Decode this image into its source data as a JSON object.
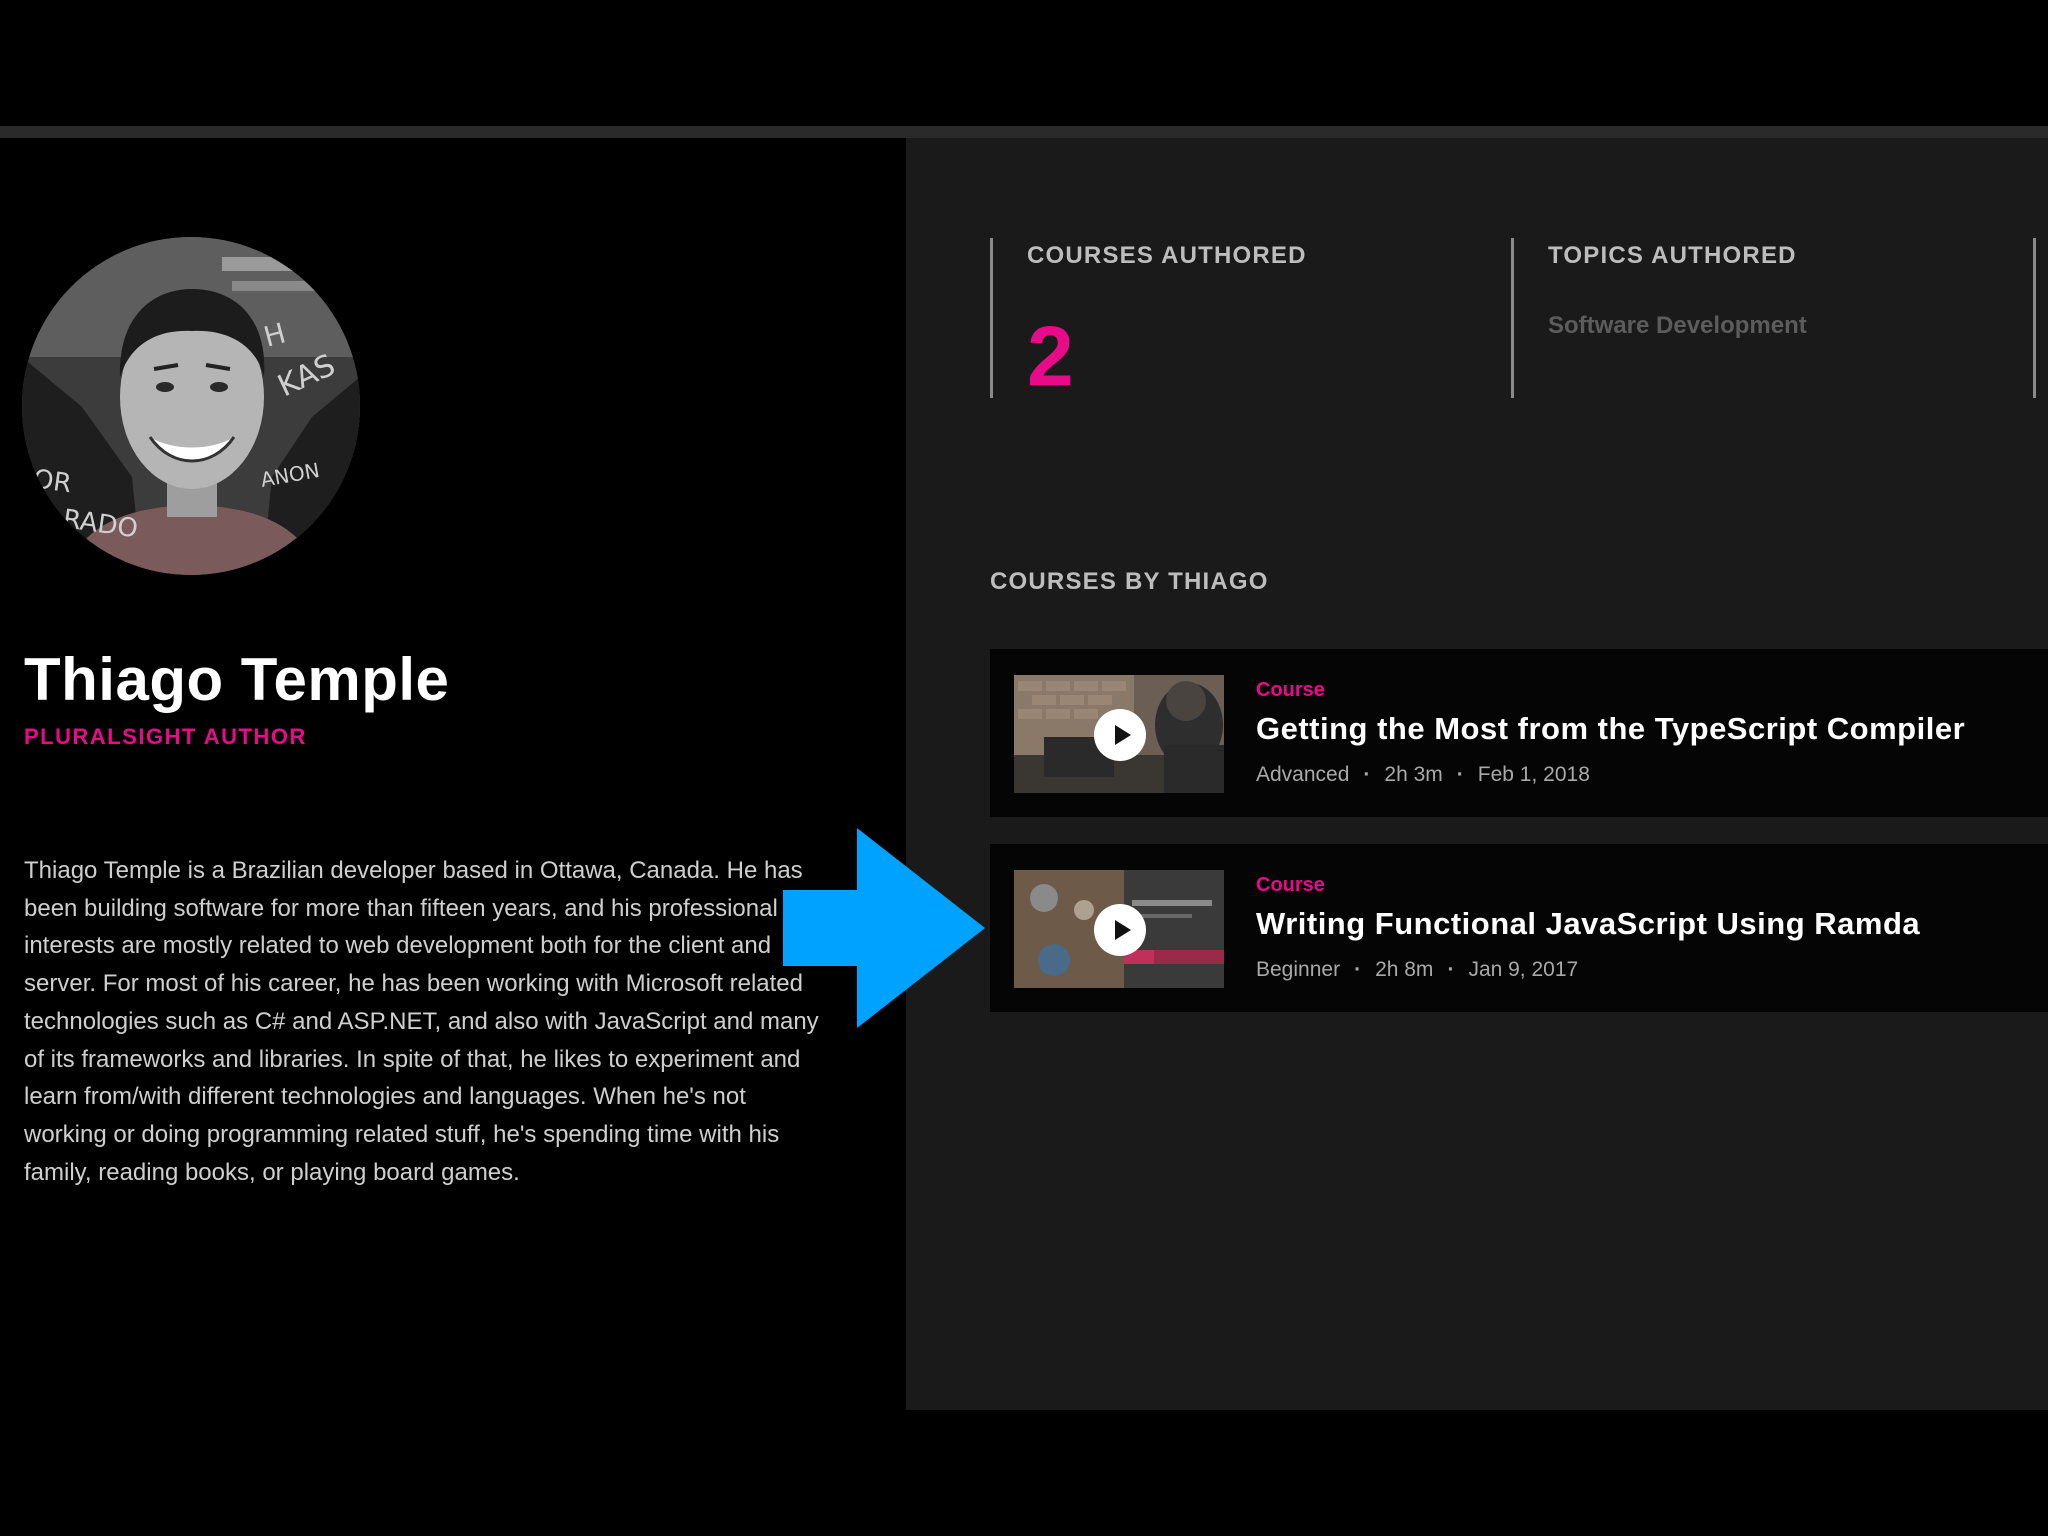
{
  "author": {
    "name": "Thiago Temple",
    "role": "PLURALSIGHT AUTHOR",
    "bio": "Thiago Temple is a Brazilian developer based in Ottawa, Canada. He has been building software for more than fifteen years, and his professional interests are mostly related to web development both for the client and server. For most of his career, he has been working with Microsoft related technologies such as C# and ASP.NET, and also with JavaScript and many of its frameworks and libraries. In spite of that, he likes to experiment and learn from/with different technologies and languages. When he's not working or doing programming related stuff, he's spending time with his family, reading books, or playing board games."
  },
  "stats": {
    "courses_label": "COURSES AUTHORED",
    "courses_value": "2",
    "topics_label": "TOPICS AUTHORED",
    "topics_value": "Software Development"
  },
  "courses_section": {
    "title": "COURSES BY THIAGO",
    "items": [
      {
        "kind": "Course",
        "title": "Getting the Most from the TypeScript Compiler",
        "level": "Advanced",
        "duration": "2h 3m",
        "date": "Feb 1, 2018"
      },
      {
        "kind": "Course",
        "title": "Writing Functional JavaScript Using Ramda",
        "level": "Beginner",
        "duration": "2h 8m",
        "date": "Jan 9, 2017"
      }
    ]
  },
  "icons": {
    "play": "play-icon",
    "annotation": "arrow-right-icon"
  },
  "colors": {
    "accent": "#e80a89",
    "annotation_arrow": "#00a2ff",
    "background": "#000000",
    "panel": "#1a1a1a"
  }
}
